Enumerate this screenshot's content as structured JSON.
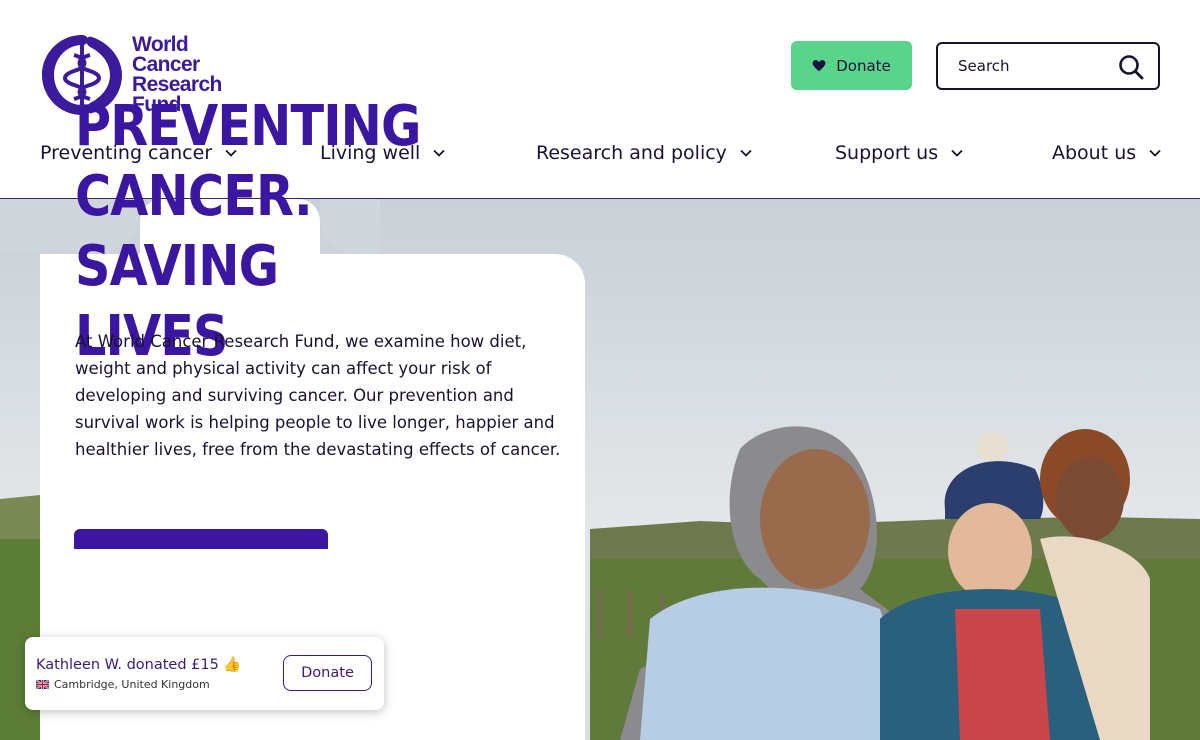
{
  "brand": {
    "logo_lines": [
      "World",
      "Cancer",
      "Research",
      "Fund"
    ],
    "color": "#3b1a9b"
  },
  "header": {
    "donate_label": "Donate",
    "search_placeholder": "Search"
  },
  "nav": [
    {
      "label": "Preventing cancer"
    },
    {
      "label": "Living well"
    },
    {
      "label": "Research and policy"
    },
    {
      "label": "Support us"
    },
    {
      "label": "About us"
    }
  ],
  "hero": {
    "title_lines": [
      "PREVENTING",
      "CANCER. SAVING",
      "LIVES"
    ],
    "body": "At World Cancer Research Fund, we examine how diet, weight and physical activity can affect your risk of developing and surviving cancer. Our prevention and survival work is helping people to live longer, happier and healthier lives, free from the devastating effects of cancer."
  },
  "toast": {
    "message": "Kathleen W. donated £15 👍",
    "location": "Cambridge, United Kingdom",
    "button_label": "Donate"
  },
  "colors": {
    "accent": "#3b16a0",
    "donate_green": "#5ad48a",
    "text_dark": "#1b1033"
  }
}
